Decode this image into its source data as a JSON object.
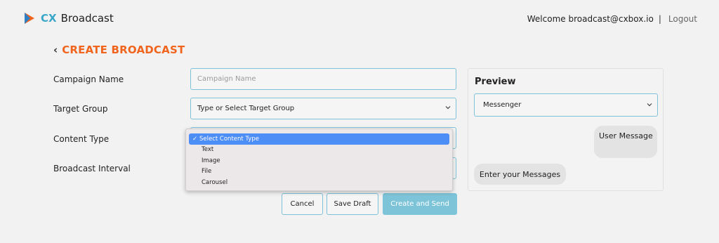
{
  "header": {
    "logo_cx": "CX",
    "logo_name": "Broadcast",
    "welcome": "Welcome broadcast@cxbox.io",
    "separator": "|",
    "logout": "Logout"
  },
  "page": {
    "back_icon": "chevron-left-icon",
    "title": "CREATE BROADCAST"
  },
  "form": {
    "campaign_name_label": "Campaign Name",
    "campaign_name_placeholder": "Campaign Name",
    "campaign_name_value": "",
    "target_group_label": "Target Group",
    "target_group_value": "Type or Select Target Group",
    "content_type_label": "Content Type",
    "broadcast_interval_label": "Broadcast Interval"
  },
  "content_type_dropdown": {
    "options": [
      "Select Content Type",
      "Text",
      "Image",
      "File",
      "Carousel"
    ],
    "selected_index": 0,
    "selected_mark": "✓"
  },
  "actions": {
    "cancel": "Cancel",
    "save_draft": "Save Draft",
    "create_and_send": "Create and Send"
  },
  "preview": {
    "title": "Preview",
    "channel": "Messenger",
    "user_message": "User Message",
    "enter_messages": "Enter your Messages"
  },
  "colors": {
    "accent": "#7fc1d8",
    "title": "#f0641e",
    "brand": "#3aa7c8",
    "dropdown_selected": "#4d8df6",
    "background": "#f2f2f2"
  }
}
